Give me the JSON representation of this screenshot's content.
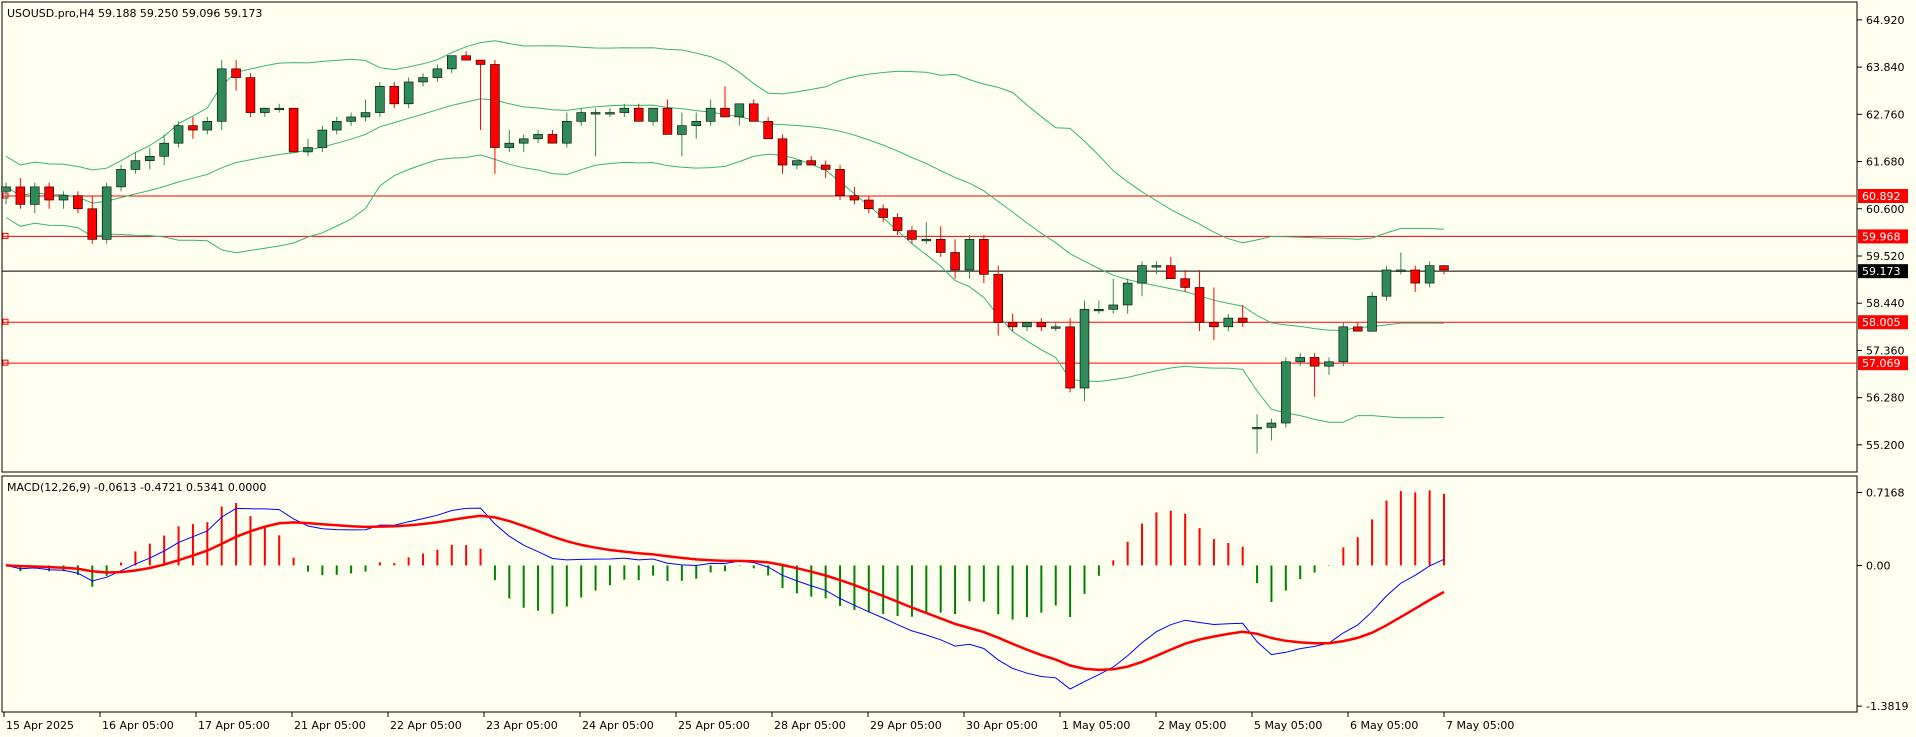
{
  "chart_data": [
    {
      "type": "candlestick",
      "symbol_header": "USOUSD.pro,H4",
      "ohlc_header": "59.188 59.250 59.096 59.173",
      "price_ticks": [
        "64.920",
        "63.840",
        "62.760",
        "61.680",
        "60.600",
        "59.520",
        "58.440",
        "57.360",
        "56.280",
        "55.200"
      ],
      "ylim": [
        54.9,
        65.1
      ],
      "x_labels": [
        "15 Apr 2025",
        "16 Apr 05:00",
        "17 Apr 05:00",
        "21 Apr 05:00",
        "22 Apr 05:00",
        "23 Apr 05:00",
        "24 Apr 05:00",
        "25 Apr 05:00",
        "28 Apr 05:00",
        "29 Apr 05:00",
        "30 Apr 05:00",
        "1 May 05:00",
        "2 May 05:00",
        "5 May 05:00",
        "6 May 05:00",
        "7 May 05:00"
      ],
      "horizontal_levels": [
        {
          "value": 60.892,
          "label": "60.892",
          "color": "#FF0000"
        },
        {
          "value": 59.968,
          "label": "59.968",
          "color": "#FF0000"
        },
        {
          "value": 58.005,
          "label": "58.005",
          "color": "#FF0000"
        },
        {
          "value": 57.069,
          "label": "57.069",
          "color": "#FF0000"
        }
      ],
      "current_price": {
        "value": 59.173,
        "label": "59.173",
        "color": "#000000"
      },
      "colors": {
        "bull": "#2E8B57",
        "bear": "#FF0000",
        "bands": "#3CB371",
        "wick": "#000000"
      },
      "candles": [
        [
          61.0,
          61.2,
          60.7,
          61.1
        ],
        [
          61.1,
          61.3,
          60.6,
          60.7
        ],
        [
          60.7,
          61.2,
          60.5,
          61.1
        ],
        [
          61.1,
          61.2,
          60.6,
          60.8
        ],
        [
          60.8,
          61.0,
          60.6,
          60.9
        ],
        [
          60.9,
          61.0,
          60.5,
          60.6
        ],
        [
          60.6,
          60.9,
          59.8,
          59.9
        ],
        [
          59.9,
          61.2,
          59.8,
          61.1
        ],
        [
          61.1,
          61.6,
          61.0,
          61.5
        ],
        [
          61.5,
          61.9,
          61.4,
          61.7
        ],
        [
          61.7,
          62.0,
          61.5,
          61.8
        ],
        [
          61.8,
          62.3,
          61.6,
          62.1
        ],
        [
          62.1,
          62.6,
          62.0,
          62.5
        ],
        [
          62.5,
          62.7,
          62.2,
          62.4
        ],
        [
          62.4,
          62.7,
          62.3,
          62.6
        ],
        [
          62.6,
          64.0,
          62.4,
          63.8
        ],
        [
          63.8,
          64.0,
          63.3,
          63.6
        ],
        [
          63.6,
          63.7,
          62.7,
          62.8
        ],
        [
          62.8,
          62.9,
          62.7,
          62.9
        ],
        [
          62.9,
          63.0,
          62.8,
          62.9
        ],
        [
          62.9,
          62.9,
          61.9,
          61.9
        ],
        [
          61.9,
          62.2,
          61.8,
          62.0
        ],
        [
          62.0,
          62.5,
          61.9,
          62.4
        ],
        [
          62.4,
          62.7,
          62.3,
          62.6
        ],
        [
          62.6,
          62.8,
          62.5,
          62.7
        ],
        [
          62.7,
          63.1,
          62.6,
          62.8
        ],
        [
          62.8,
          63.5,
          62.7,
          63.4
        ],
        [
          63.4,
          63.5,
          62.9,
          63.0
        ],
        [
          63.0,
          63.6,
          62.9,
          63.5
        ],
        [
          63.5,
          63.7,
          63.4,
          63.6
        ],
        [
          63.6,
          63.9,
          63.5,
          63.8
        ],
        [
          63.8,
          64.1,
          63.7,
          64.1
        ],
        [
          64.1,
          64.2,
          64.0,
          64.0
        ],
        [
          64.0,
          64.0,
          62.4,
          63.9
        ],
        [
          63.9,
          64.0,
          61.4,
          62.0
        ],
        [
          62.0,
          62.4,
          61.9,
          62.1
        ],
        [
          62.1,
          62.3,
          61.9,
          62.2
        ],
        [
          62.2,
          62.4,
          62.1,
          62.3
        ],
        [
          62.3,
          62.4,
          62.1,
          62.1
        ],
        [
          62.1,
          62.8,
          62.0,
          62.6
        ],
        [
          62.6,
          62.9,
          62.5,
          62.8
        ],
        [
          62.8,
          62.9,
          61.8,
          62.8
        ],
        [
          62.8,
          62.9,
          62.7,
          62.8
        ],
        [
          62.8,
          63.0,
          62.7,
          62.9
        ],
        [
          62.9,
          63.0,
          62.6,
          62.6
        ],
        [
          62.6,
          62.9,
          62.5,
          62.9
        ],
        [
          62.9,
          63.1,
          62.3,
          62.3
        ],
        [
          62.3,
          62.8,
          61.8,
          62.5
        ],
        [
          62.5,
          62.8,
          62.2,
          62.6
        ],
        [
          62.6,
          63.1,
          62.5,
          62.9
        ],
        [
          62.9,
          63.4,
          62.8,
          62.7
        ],
        [
          62.7,
          63.0,
          62.5,
          63.0
        ],
        [
          63.0,
          63.1,
          62.6,
          62.6
        ],
        [
          62.6,
          62.7,
          62.2,
          62.2
        ],
        [
          62.2,
          62.3,
          61.4,
          61.6
        ],
        [
          61.6,
          61.7,
          61.5,
          61.7
        ],
        [
          61.7,
          61.8,
          61.6,
          61.6
        ],
        [
          61.6,
          61.7,
          61.3,
          61.5
        ],
        [
          61.5,
          61.6,
          60.8,
          60.9
        ],
        [
          60.9,
          61.1,
          60.7,
          60.8
        ],
        [
          60.8,
          60.9,
          60.5,
          60.6
        ],
        [
          60.6,
          60.7,
          60.3,
          60.4
        ],
        [
          60.4,
          60.5,
          60.0,
          60.1
        ],
        [
          60.1,
          60.2,
          59.8,
          59.9
        ],
        [
          59.9,
          60.3,
          59.8,
          59.9
        ],
        [
          59.9,
          60.2,
          59.5,
          59.6
        ],
        [
          59.6,
          59.9,
          59.0,
          59.2
        ],
        [
          59.2,
          60.0,
          59.0,
          59.9
        ],
        [
          59.9,
          60.0,
          58.9,
          59.1
        ],
        [
          59.1,
          59.3,
          57.7,
          58.0
        ],
        [
          58.0,
          58.2,
          57.8,
          57.9
        ],
        [
          57.9,
          58.0,
          57.8,
          58.0
        ],
        [
          58.0,
          58.1,
          57.8,
          57.9
        ],
        [
          57.9,
          58.0,
          57.8,
          57.9
        ],
        [
          57.9,
          58.1,
          56.4,
          56.5
        ],
        [
          56.5,
          58.5,
          56.2,
          58.3
        ],
        [
          58.3,
          58.5,
          58.2,
          58.3
        ],
        [
          58.3,
          59.0,
          58.2,
          58.4
        ],
        [
          58.4,
          59.0,
          58.2,
          58.9
        ],
        [
          58.9,
          59.4,
          58.6,
          59.3
        ],
        [
          59.3,
          59.4,
          59.1,
          59.3
        ],
        [
          59.3,
          59.5,
          59.0,
          59.0
        ],
        [
          59.0,
          59.2,
          58.7,
          58.8
        ],
        [
          58.8,
          59.2,
          57.8,
          58.0
        ],
        [
          58.0,
          58.8,
          57.6,
          57.9
        ],
        [
          57.9,
          58.2,
          57.8,
          58.1
        ],
        [
          58.1,
          58.4,
          57.9,
          58.0
        ],
        [
          55.6,
          55.9,
          55.0,
          55.6
        ],
        [
          55.6,
          55.8,
          55.3,
          55.7
        ],
        [
          55.7,
          57.2,
          55.6,
          57.1
        ],
        [
          57.1,
          57.3,
          57.0,
          57.2
        ],
        [
          57.2,
          57.3,
          56.3,
          57.0
        ],
        [
          57.0,
          57.2,
          56.8,
          57.1
        ],
        [
          57.1,
          58.0,
          57.0,
          57.9
        ],
        [
          57.9,
          58.0,
          57.8,
          57.8
        ],
        [
          57.8,
          58.7,
          57.8,
          58.6
        ],
        [
          58.6,
          59.3,
          58.5,
          59.2
        ],
        [
          59.2,
          59.6,
          59.1,
          59.2
        ],
        [
          59.2,
          59.3,
          58.7,
          58.9
        ],
        [
          58.9,
          59.4,
          58.8,
          59.3
        ],
        [
          59.3,
          59.3,
          59.1,
          59.2
        ]
      ]
    },
    {
      "type": "macd",
      "header": "MACD(12,26,9) -0.0613 -0.4721 0.5341 0.0000",
      "ticks": [
        "0.7168",
        "0.00",
        "-1.3819"
      ],
      "ylim": [
        -1.4,
        0.78
      ],
      "hist_colors": {
        "pos": "#FF0000",
        "neg": "#008000"
      },
      "line_colors": {
        "macd": "#0000FF",
        "signal": "#FF0000"
      }
    }
  ]
}
